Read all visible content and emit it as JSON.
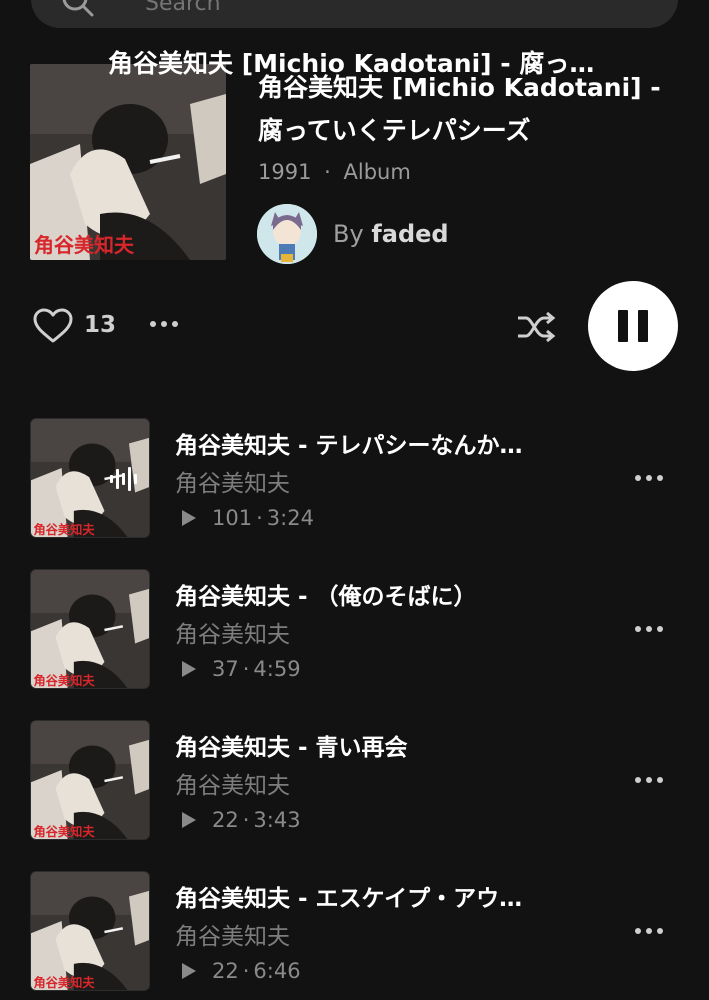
{
  "search": {
    "placeholder": "Search"
  },
  "header_overlay_title": "角谷美知夫 [Michio Kadotani] - 腐っ…",
  "album": {
    "title": "角谷美知夫 [Michio Kadotani] - 腐っていくテレパシーズ",
    "year": "1991",
    "separator": "·",
    "type": "Album",
    "by_label": "By",
    "owner": "faded",
    "cover_text": "角谷美知夫"
  },
  "actions": {
    "like_count": "13",
    "icons": [
      "heart-icon",
      "more-icon",
      "shuffle-icon",
      "pause-icon"
    ]
  },
  "tracks": [
    {
      "title": "角谷美知夫 - テレパシーなんか…",
      "artist": "角谷美知夫",
      "plays": "101",
      "duration": "3:24",
      "playing": true
    },
    {
      "title": "角谷美知夫 - （俺のそばに）",
      "artist": "角谷美知夫",
      "plays": "37",
      "duration": "4:59",
      "playing": false
    },
    {
      "title": "角谷美知夫 - 青い再会",
      "artist": "角谷美知夫",
      "plays": "22",
      "duration": "3:43",
      "playing": false
    },
    {
      "title": "角谷美知夫 - エスケイプ・アウ…",
      "artist": "角谷美知夫",
      "plays": "22",
      "duration": "6:46",
      "playing": false
    }
  ],
  "track_stat_separator": "·",
  "colors": {
    "background": "#121212",
    "accent_button": "#ffffff",
    "muted_text": "#9b9b9b"
  }
}
